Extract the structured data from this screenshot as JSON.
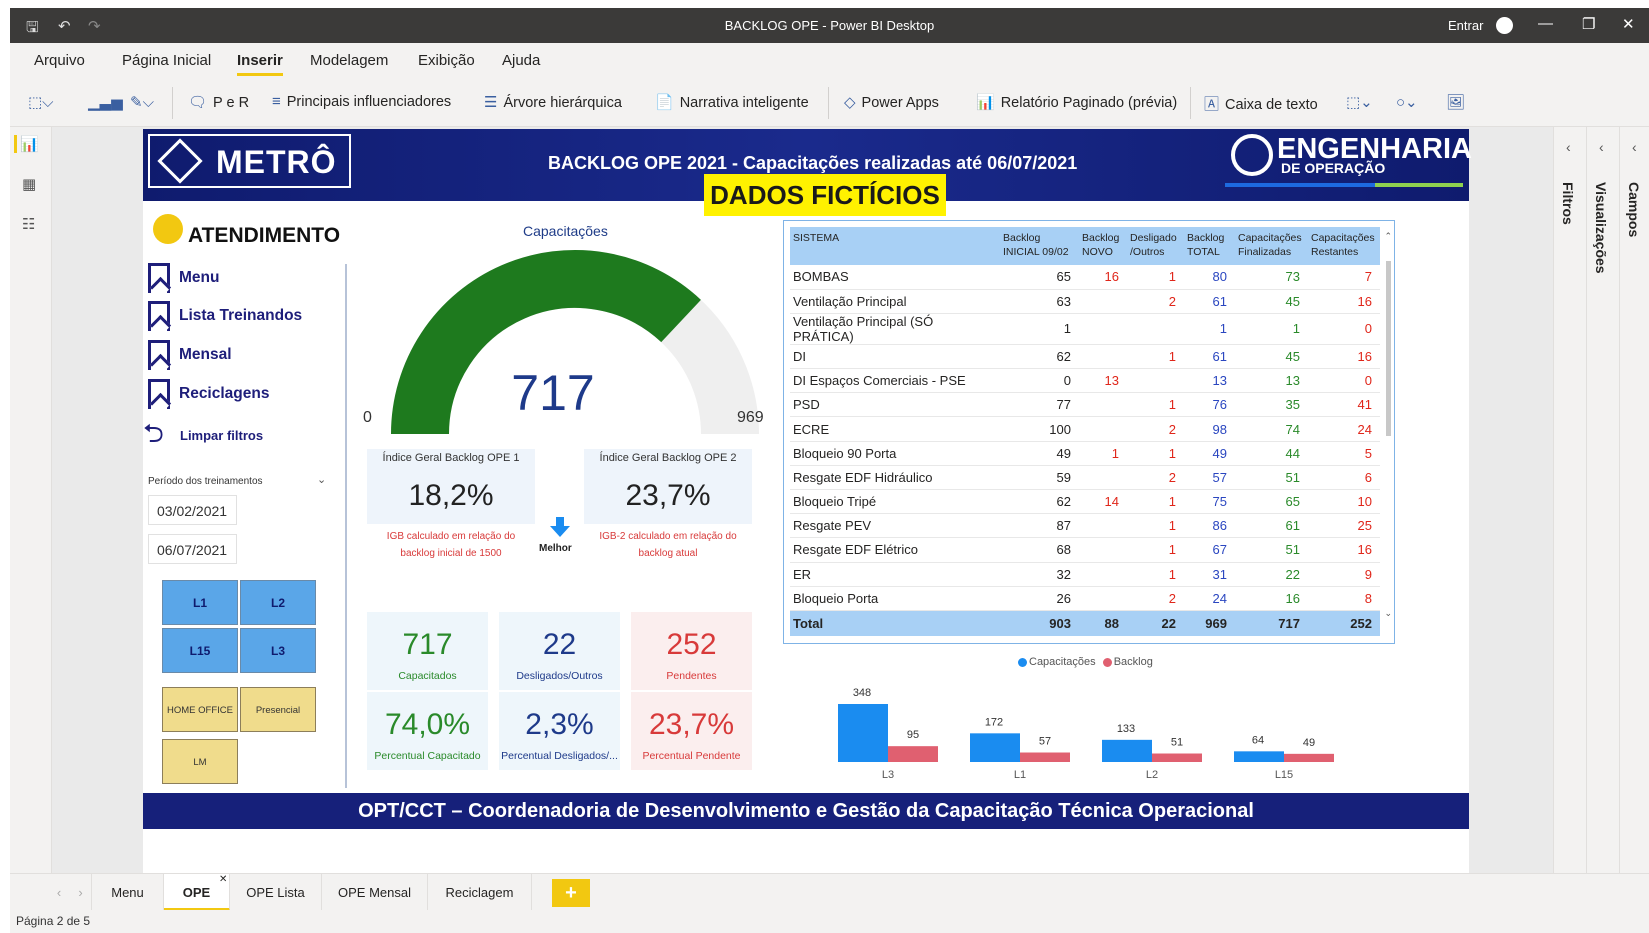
{
  "window": {
    "title": "BACKLOG OPE - Power BI Desktop",
    "entrar": "Entrar"
  },
  "menu": [
    "Arquivo",
    "Página Inicial",
    "Inserir",
    "Modelagem",
    "Exibição",
    "Ajuda"
  ],
  "ribbon": {
    "per": "P e R",
    "influenciadores": "Principais influenciadores",
    "arvore": "Árvore hierárquica",
    "narrativa": "Narrativa inteligente",
    "powerapps": "Power Apps",
    "paginado": "Relatório Paginado (prévia)",
    "caixa": "Caixa de texto"
  },
  "header": {
    "metro": "METRÔ",
    "title": "BACKLOG OPE 2021 - Capacitações realizadas até  06/07/2021",
    "eng_big": "ENGENHARIA",
    "eng_small": "DE OPERAÇÃO",
    "ficticios": "DADOS FICTÍCIOS"
  },
  "nav": {
    "heading": "ATENDIMENTO",
    "items": [
      "Menu",
      "Lista Treinandos",
      "Mensal",
      "Reciclagens"
    ],
    "clear": "Limpar filtros"
  },
  "periodo": {
    "label": "Período dos treinamentos",
    "start": "03/02/2021",
    "end": "06/07/2021"
  },
  "slicer_lines": [
    "L1",
    "L2",
    "L15",
    "L3"
  ],
  "slicer_modes": [
    "HOME OFFICE",
    "Presencial",
    "LM"
  ],
  "gauge": {
    "title": "Capacitações",
    "value": 717,
    "min": 0,
    "max": 969,
    "fill_color": "#1e7a1e",
    "track_color": "#efefef"
  },
  "indices": [
    {
      "title": "Índice Geral Backlog OPE 1",
      "value": "18,2%",
      "note1": "IGB calculado em relação do",
      "note2": "backlog inicial de 1500"
    },
    {
      "title": "Índice Geral Backlog OPE 2",
      "value": "23,7%",
      "note1": "IGB-2 calculado em relação do",
      "note2": "backlog atual"
    }
  ],
  "melhor": "Melhor",
  "kpis": [
    {
      "value": "717",
      "label": "Capacitados",
      "color": "#2a8a2a"
    },
    {
      "value": "22",
      "label": "Desligados/Outros",
      "color": "#1e3a8a"
    },
    {
      "value": "252",
      "label": "Pendentes",
      "color": "#d83a3a"
    },
    {
      "value": "74,0%",
      "label": "Percentual Capacitado",
      "color": "#2a8a2a"
    },
    {
      "value": "2,3%",
      "label": "Percentual Desligados/...",
      "color": "#1e3a8a"
    },
    {
      "value": "23,7%",
      "label": "Percentual Pendente",
      "color": "#d83a3a"
    }
  ],
  "table": {
    "headers": [
      [
        "SISTEMA",
        ""
      ],
      [
        "Backlog",
        "INICIAL 09/02"
      ],
      [
        "Backlog",
        "NOVO"
      ],
      [
        "Desligado",
        "/Outros"
      ],
      [
        "Backlog",
        "TOTAL"
      ],
      [
        "Capacitações",
        "Finalizadas"
      ],
      [
        "Capacitações",
        "Restantes"
      ]
    ],
    "rows": [
      [
        "BOMBAS",
        "65",
        "16",
        "1",
        "80",
        "73",
        "7"
      ],
      [
        "Ventilação Principal",
        "63",
        "",
        "2",
        "61",
        "45",
        "16"
      ],
      [
        "Ventilação Principal (SÓ PRÁTICA)",
        "1",
        "",
        "",
        "1",
        "1",
        "0"
      ],
      [
        "DI",
        "62",
        "",
        "1",
        "61",
        "45",
        "16"
      ],
      [
        "DI Espaços Comerciais - PSE",
        "0",
        "13",
        "",
        "13",
        "13",
        "0"
      ],
      [
        "PSD",
        "77",
        "",
        "1",
        "76",
        "35",
        "41"
      ],
      [
        "ECRE",
        "100",
        "",
        "2",
        "98",
        "74",
        "24"
      ],
      [
        "Bloqueio 90 Porta",
        "49",
        "1",
        "1",
        "49",
        "44",
        "5"
      ],
      [
        "Resgate EDF Hidráulico",
        "59",
        "",
        "2",
        "57",
        "51",
        "6"
      ],
      [
        "Bloqueio Tripé",
        "62",
        "14",
        "1",
        "75",
        "65",
        "10"
      ],
      [
        "Resgate PEV",
        "87",
        "",
        "1",
        "86",
        "61",
        "25"
      ],
      [
        "Resgate EDF Elétrico",
        "68",
        "",
        "1",
        "67",
        "51",
        "16"
      ],
      [
        "ER",
        "32",
        "",
        "1",
        "31",
        "22",
        "9"
      ],
      [
        "Bloqueio Porta",
        "26",
        "",
        "2",
        "24",
        "16",
        "8"
      ]
    ],
    "total": [
      "Total",
      "903",
      "88",
      "22",
      "969",
      "717",
      "252"
    ]
  },
  "chart_data": {
    "type": "bar",
    "categories": [
      "L3",
      "L1",
      "L2",
      "L15"
    ],
    "series": [
      {
        "name": "Capacitações",
        "values": [
          348,
          172,
          133,
          64
        ],
        "color": "#1a8cf0"
      },
      {
        "name": "Backlog",
        "values": [
          95,
          57,
          51,
          49
        ],
        "color": "#e06070"
      }
    ]
  },
  "footer": "OPT/CCT – Coordenadoria de Desenvolvimento e Gestão da Capacitação Técnica Operacional",
  "panes": {
    "filtros": "Filtros",
    "visualizacoes": "Visualizações",
    "campos": "Campos"
  },
  "tabs": [
    "Menu",
    "OPE",
    "OPE Lista",
    "OPE Mensal",
    "Reciclagem"
  ],
  "status": "Página 2 de 5"
}
